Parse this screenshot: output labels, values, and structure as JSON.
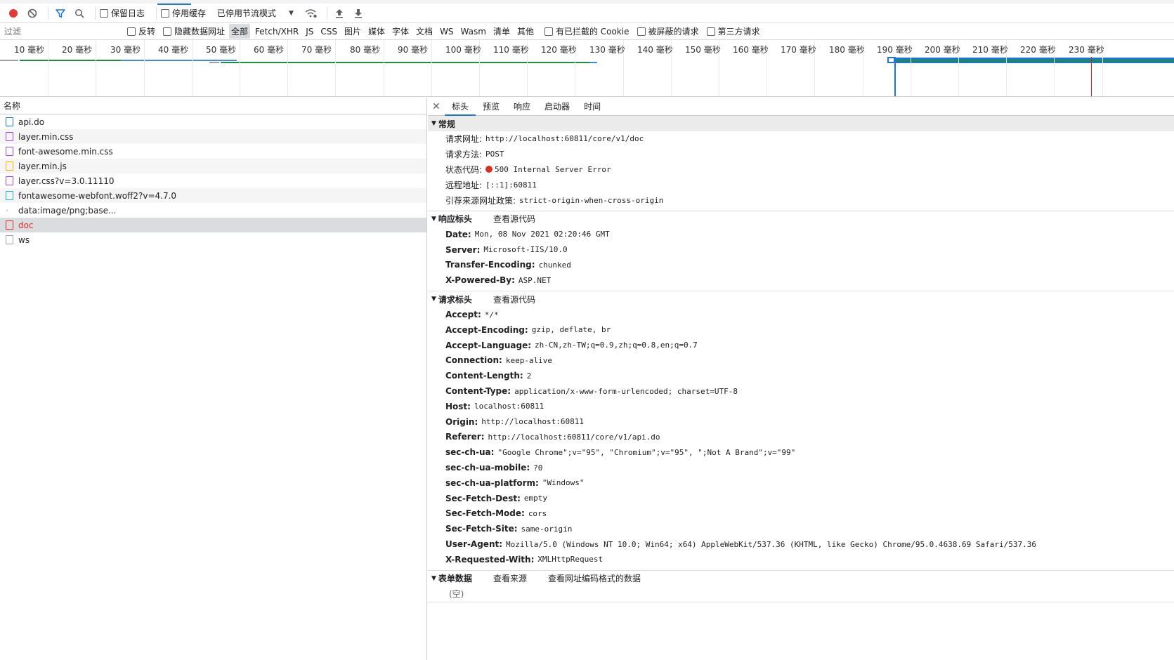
{
  "toolbar": {
    "preserve_log": "保留日志",
    "disable_cache": "停用缓存",
    "throttling": "已停用节流模式"
  },
  "filterbar": {
    "placeholder": "过滤",
    "invert": "反转",
    "hide_data_urls": "隐藏数据网址",
    "types": [
      "全部",
      "Fetch/XHR",
      "JS",
      "CSS",
      "图片",
      "媒体",
      "字体",
      "文档",
      "WS",
      "Wasm",
      "清单",
      "其他"
    ],
    "active_type": "全部",
    "blocked_cookies": "有已拦截的 Cookie",
    "blocked_requests": "被屏蔽的请求",
    "third_party": "第三方请求"
  },
  "timeline": {
    "ticks": [
      "10 毫秒",
      "20 毫秒",
      "30 毫秒",
      "40 毫秒",
      "50 毫秒",
      "60 毫秒",
      "70 毫秒",
      "80 毫秒",
      "90 毫秒",
      "100 毫秒",
      "110 毫秒",
      "120 毫秒",
      "130 毫秒",
      "140 毫秒",
      "150 毫秒",
      "160 毫秒",
      "170 毫秒",
      "180 毫秒",
      "190 毫秒",
      "200 毫秒",
      "210 毫秒",
      "220 毫秒",
      "230 毫秒"
    ]
  },
  "requests": {
    "column_name": "名称",
    "items": [
      {
        "name": "api.do",
        "type": "doc"
      },
      {
        "name": "layer.min.css",
        "type": "css"
      },
      {
        "name": "font-awesome.min.css",
        "type": "css"
      },
      {
        "name": "layer.min.js",
        "type": "js"
      },
      {
        "name": "layer.css?v=3.0.11110",
        "type": "css"
      },
      {
        "name": "fontawesome-webfont.woff2?v=4.7.0",
        "type": "font"
      },
      {
        "name": "data:image/png;base...",
        "type": "img"
      },
      {
        "name": "doc",
        "type": "err"
      },
      {
        "name": "ws",
        "type": "ws"
      }
    ]
  },
  "details": {
    "tabs": [
      "标头",
      "预览",
      "响应",
      "启动器",
      "时间"
    ],
    "general": {
      "title": "常规",
      "rows": [
        {
          "k": "请求网址:",
          "v": "http://localhost:60811/core/v1/doc"
        },
        {
          "k": "请求方法:",
          "v": "POST"
        },
        {
          "k": "状态代码:",
          "v": "500 Internal Server Error"
        },
        {
          "k": "远程地址:",
          "v": "[::1]:60811"
        },
        {
          "k": "引荐来源网址政策:",
          "v": "strict-origin-when-cross-origin"
        }
      ]
    },
    "response_headers": {
      "title": "响应标头",
      "link": "查看源代码",
      "rows": [
        {
          "k": "Date:",
          "v": "Mon, 08 Nov 2021 02:20:46 GMT"
        },
        {
          "k": "Server:",
          "v": "Microsoft-IIS/10.0"
        },
        {
          "k": "Transfer-Encoding:",
          "v": "chunked"
        },
        {
          "k": "X-Powered-By:",
          "v": "ASP.NET"
        }
      ]
    },
    "request_headers": {
      "title": "请求标头",
      "link": "查看源代码",
      "rows": [
        {
          "k": "Accept:",
          "v": "*/*"
        },
        {
          "k": "Accept-Encoding:",
          "v": "gzip, deflate, br"
        },
        {
          "k": "Accept-Language:",
          "v": "zh-CN,zh-TW;q=0.9,zh;q=0.8,en;q=0.7"
        },
        {
          "k": "Connection:",
          "v": "keep-alive"
        },
        {
          "k": "Content-Length:",
          "v": "2"
        },
        {
          "k": "Content-Type:",
          "v": "application/x-www-form-urlencoded; charset=UTF-8"
        },
        {
          "k": "Host:",
          "v": "localhost:60811"
        },
        {
          "k": "Origin:",
          "v": "http://localhost:60811"
        },
        {
          "k": "Referer:",
          "v": "http://localhost:60811/core/v1/api.do"
        },
        {
          "k": "sec-ch-ua:",
          "v": "\"Google Chrome\";v=\"95\", \"Chromium\";v=\"95\", \";Not A Brand\";v=\"99\""
        },
        {
          "k": "sec-ch-ua-mobile:",
          "v": "?0"
        },
        {
          "k": "sec-ch-ua-platform:",
          "v": "\"Windows\""
        },
        {
          "k": "Sec-Fetch-Dest:",
          "v": "empty"
        },
        {
          "k": "Sec-Fetch-Mode:",
          "v": "cors"
        },
        {
          "k": "Sec-Fetch-Site:",
          "v": "same-origin"
        },
        {
          "k": "User-Agent:",
          "v": "Mozilla/5.0 (Windows NT 10.0; Win64; x64) AppleWebKit/537.36 (KHTML, like Gecko) Chrome/95.0.4638.69 Safari/537.36"
        },
        {
          "k": "X-Requested-With:",
          "v": "XMLHttpRequest"
        }
      ]
    },
    "form_data": {
      "title": "表单数据",
      "link_source": "查看来源",
      "link_urlencoded": "查看网址编码格式的数据",
      "empty": "(空)"
    }
  },
  "colors": {
    "accent": "#1a73e8",
    "error": "#d93025",
    "record": "#e53935"
  }
}
